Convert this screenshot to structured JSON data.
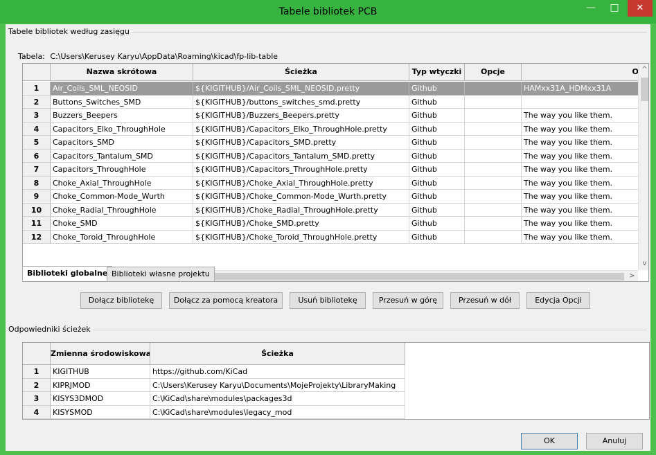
{
  "window": {
    "title": "Tabele bibliotek PCB",
    "minimize_glyph": "—",
    "maximize_glyph": "□",
    "close_glyph": "✕"
  },
  "libraries_group": {
    "label": "Tabele bibliotek według zasięgu",
    "table_path_label": "Tabela:",
    "table_path": "C:\\Users\\Kerusey Karyu\\AppData\\Roaming\\kicad\\fp-lib-table",
    "columns": [
      "Nazwa skrótowa",
      "Ścieżka",
      "Typ wtyczki",
      "Opcje",
      "Opis"
    ],
    "selected_row": 0,
    "rows": [
      {
        "num": "1",
        "name": "Air_Coils_SML_NEOSID",
        "path": "${KIGITHUB}/Air_Coils_SML_NEOSID.pretty",
        "type": "Github",
        "options": "",
        "desc": "HAMxx31A_HDMxx31A"
      },
      {
        "num": "2",
        "name": "Buttons_Switches_SMD",
        "path": "${KIGITHUB}/buttons_switches_smd.pretty",
        "type": "Github",
        "options": "",
        "desc": ""
      },
      {
        "num": "3",
        "name": "Buzzers_Beepers",
        "path": "${KIGITHUB}/Buzzers_Beepers.pretty",
        "type": "Github",
        "options": "",
        "desc": "The way you like them."
      },
      {
        "num": "4",
        "name": "Capacitors_Elko_ThroughHole",
        "path": "${KIGITHUB}/Capacitors_Elko_ThroughHole.pretty",
        "type": "Github",
        "options": "",
        "desc": "The way you like them."
      },
      {
        "num": "5",
        "name": "Capacitors_SMD",
        "path": "${KIGITHUB}/Capacitors_SMD.pretty",
        "type": "Github",
        "options": "",
        "desc": "The way you like them."
      },
      {
        "num": "6",
        "name": "Capacitors_Tantalum_SMD",
        "path": "${KIGITHUB}/Capacitors_Tantalum_SMD.pretty",
        "type": "Github",
        "options": "",
        "desc": "The way you like them."
      },
      {
        "num": "7",
        "name": "Capacitors_ThroughHole",
        "path": "${KIGITHUB}/Capacitors_ThroughHole.pretty",
        "type": "Github",
        "options": "",
        "desc": "The way you like them."
      },
      {
        "num": "8",
        "name": "Choke_Axial_ThroughHole",
        "path": "${KIGITHUB}/Choke_Axial_ThroughHole.pretty",
        "type": "Github",
        "options": "",
        "desc": "The way you like them."
      },
      {
        "num": "9",
        "name": "Choke_Common-Mode_Wurth",
        "path": "${KIGITHUB}/Choke_Common-Mode_Wurth.pretty",
        "type": "Github",
        "options": "",
        "desc": "The way you like them."
      },
      {
        "num": "10",
        "name": "Choke_Radial_ThroughHole",
        "path": "${KIGITHUB}/Choke_Radial_ThroughHole.pretty",
        "type": "Github",
        "options": "",
        "desc": "The way you like them."
      },
      {
        "num": "11",
        "name": "Choke_SMD",
        "path": "${KIGITHUB}/Choke_SMD.pretty",
        "type": "Github",
        "options": "",
        "desc": "The way you like them."
      },
      {
        "num": "12",
        "name": "Choke_Toroid_ThroughHole",
        "path": "${KIGITHUB}/Choke_Toroid_ThroughHole.pretty",
        "type": "Github",
        "options": "",
        "desc": "The way you like them."
      }
    ],
    "tabs": [
      "Biblioteki globalne",
      "Biblioteki własne projektu"
    ],
    "active_tab": 0,
    "buttons": [
      "Dołącz bibliotekę",
      "Dołącz za pomocą kreatora",
      "Usuń bibliotekę",
      "Przesuń w górę",
      "Przesuń w dół",
      "Edycja Opcji"
    ]
  },
  "path_subs_group": {
    "label": "Odpowiedniki ścieżek",
    "columns": [
      "Zmienna środowiskowa",
      "Ścieżka"
    ],
    "rows": [
      {
        "num": "1",
        "var": "KIGITHUB",
        "path": "https://github.com/KiCad"
      },
      {
        "num": "2",
        "var": "KIPRJMOD",
        "path": "C:\\Users\\Kerusey Karyu\\Documents\\MojeProjekty\\LibraryMaking"
      },
      {
        "num": "3",
        "var": "KISYS3DMOD",
        "path": "C:\\KiCad\\share\\modules\\packages3d"
      },
      {
        "num": "4",
        "var": "KISYSMOD",
        "path": "C:\\KiCad\\share\\modules\\legacy_mod"
      }
    ]
  },
  "dialog_buttons": {
    "ok": "OK",
    "cancel": "Anuluj"
  },
  "scroll_glyphs": {
    "up": "^",
    "down": "v",
    "left": "<",
    "right": ">"
  },
  "colors": {
    "titlebar": "#37b340",
    "close_button": "#c7392f",
    "selected_row": "#9a9a9a"
  }
}
